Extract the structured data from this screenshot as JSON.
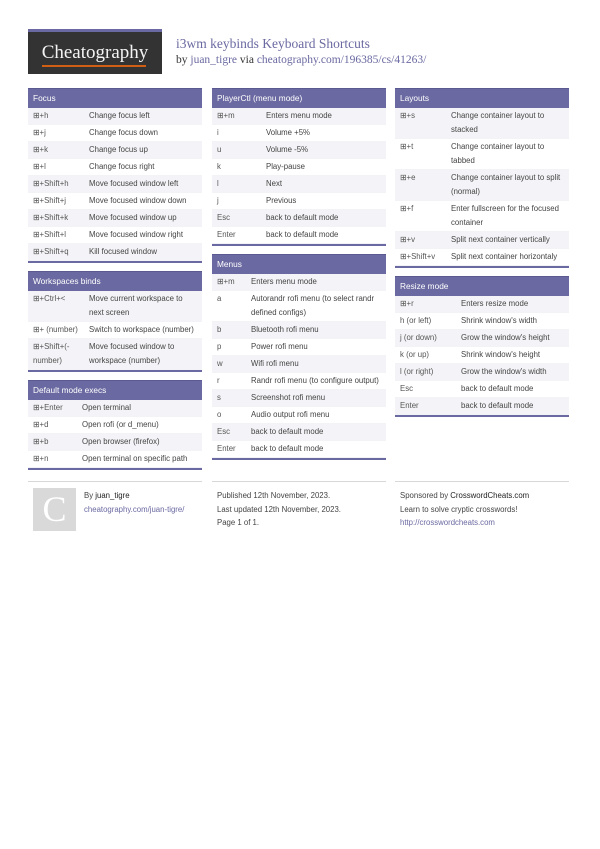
{
  "header": {
    "logo_text": "Cheatography",
    "title": "i3wm keybinds Keyboard Shortcuts",
    "by_prefix": "by",
    "author": "juan_tigre",
    "via": "via",
    "url": "cheatography.com/196385/cs/41263/"
  },
  "colors": {
    "accent": "#6a69a1",
    "logo_bg": "#333333",
    "logo_underline": "#d05f14",
    "row_stripe": "#f4f4f8"
  },
  "sections": {
    "focus": {
      "title": "Focus",
      "rows": [
        {
          "key": "⊞+h",
          "desc": "Change focus left"
        },
        {
          "key": "⊞+j",
          "desc": "Change focus down"
        },
        {
          "key": "⊞+k",
          "desc": "Change focus up"
        },
        {
          "key": "⊞+l",
          "desc": "Change focus right"
        },
        {
          "key": "⊞+Shift+h",
          "desc": "Move focused window left"
        },
        {
          "key": "⊞+Shift+j",
          "desc": "Move focused window down"
        },
        {
          "key": "⊞+Shift+k",
          "desc": "Move focused window up"
        },
        {
          "key": "⊞+Shift+l",
          "desc": "Move focused window right"
        },
        {
          "key": "⊞+Shift+q",
          "desc": "Kill focused window"
        }
      ]
    },
    "workspaces": {
      "title": "Workspaces binds",
      "rows": [
        {
          "key": "⊞+Ctrl+<",
          "desc": "Move current workspace to next screen"
        },
        {
          "key": "⊞+ (number)",
          "desc": "Switch to workspace (number)"
        },
        {
          "key": "⊞+Shift+(-number)",
          "desc": "Move focused window to workspace (number)"
        }
      ]
    },
    "default_mode": {
      "title": "Default mode execs",
      "rows": [
        {
          "key": "⊞+Enter",
          "desc": "Open terminal"
        },
        {
          "key": "⊞+d",
          "desc": "Open rofi (or d_menu)"
        },
        {
          "key": "⊞+b",
          "desc": "Open browser (firefox)"
        },
        {
          "key": "⊞+n",
          "desc": "Open terminal on specific path"
        }
      ]
    },
    "playerctl": {
      "title": "PlayerCtl (menu mode)",
      "rows": [
        {
          "key": "⊞+m",
          "desc": "Enters menu mode"
        },
        {
          "key": "i",
          "desc": "Volume +5%"
        },
        {
          "key": "u",
          "desc": "Volume -5%"
        },
        {
          "key": "k",
          "desc": "Play-pause"
        },
        {
          "key": "l",
          "desc": "Next"
        },
        {
          "key": "j",
          "desc": "Previous"
        },
        {
          "key": "Esc",
          "desc": "back to default mode"
        },
        {
          "key": "Enter",
          "desc": "back to default mode"
        }
      ]
    },
    "menus": {
      "title": "Menus",
      "rows": [
        {
          "key": "⊞+m",
          "desc": "Enters menu mode"
        },
        {
          "key": "a",
          "desc": "Autorandr rofi menu (to select randr defined configs)"
        },
        {
          "key": "b",
          "desc": "Bluetooth rofi menu"
        },
        {
          "key": "p",
          "desc": "Power rofi menu"
        },
        {
          "key": "w",
          "desc": "Wifi rofi menu"
        },
        {
          "key": "r",
          "desc": "Randr rofi menu (to configure output)"
        },
        {
          "key": "s",
          "desc": "Screenshot rofi menu"
        },
        {
          "key": "o",
          "desc": "Audio output rofi menu"
        },
        {
          "key": "Esc",
          "desc": "back to default mode"
        },
        {
          "key": "Enter",
          "desc": "back to default mode"
        }
      ]
    },
    "layouts": {
      "title": "Layouts",
      "rows": [
        {
          "key": "⊞+s",
          "desc": "Change container layout to stacked"
        },
        {
          "key": "⊞+t",
          "desc": "Change container layout to tabbed"
        },
        {
          "key": "⊞+e",
          "desc": "Change container layout to split (normal)"
        },
        {
          "key": "⊞+f",
          "desc": "Enter fullscreen for the focused container"
        },
        {
          "key": "⊞+v",
          "desc": "Split next container vertically"
        },
        {
          "key": "⊞+Shift+v",
          "desc": "Split next container horizontaly"
        }
      ]
    },
    "resize": {
      "title": "Resize mode",
      "rows": [
        {
          "key": "⊞+r",
          "desc": "Enters resize mode"
        },
        {
          "key": "h (or left)",
          "desc": "Shrink window's width"
        },
        {
          "key": "j (or down)",
          "desc": "Grow the window's height"
        },
        {
          "key": "k (or up)",
          "desc": "Shrink window's height"
        },
        {
          "key": "l (or right)",
          "desc": "Grow the window's width"
        },
        {
          "key": "Esc",
          "desc": "back to default mode"
        },
        {
          "key": "Enter",
          "desc": "back to default mode"
        }
      ]
    }
  },
  "footer": {
    "avatar_letter": "C",
    "by_label": "By",
    "author": "juan_tigre",
    "author_url": "cheatography.com/juan-tigre/",
    "published": "Published 12th November, 2023.",
    "updated": "Last updated 12th November, 2023.",
    "page": "Page 1 of 1.",
    "sponsor_prefix": "Sponsored by",
    "sponsor_name": "CrosswordCheats.com",
    "sponsor_tagline": "Learn to solve cryptic crosswords!",
    "sponsor_url": "http://crosswordcheats.com"
  }
}
